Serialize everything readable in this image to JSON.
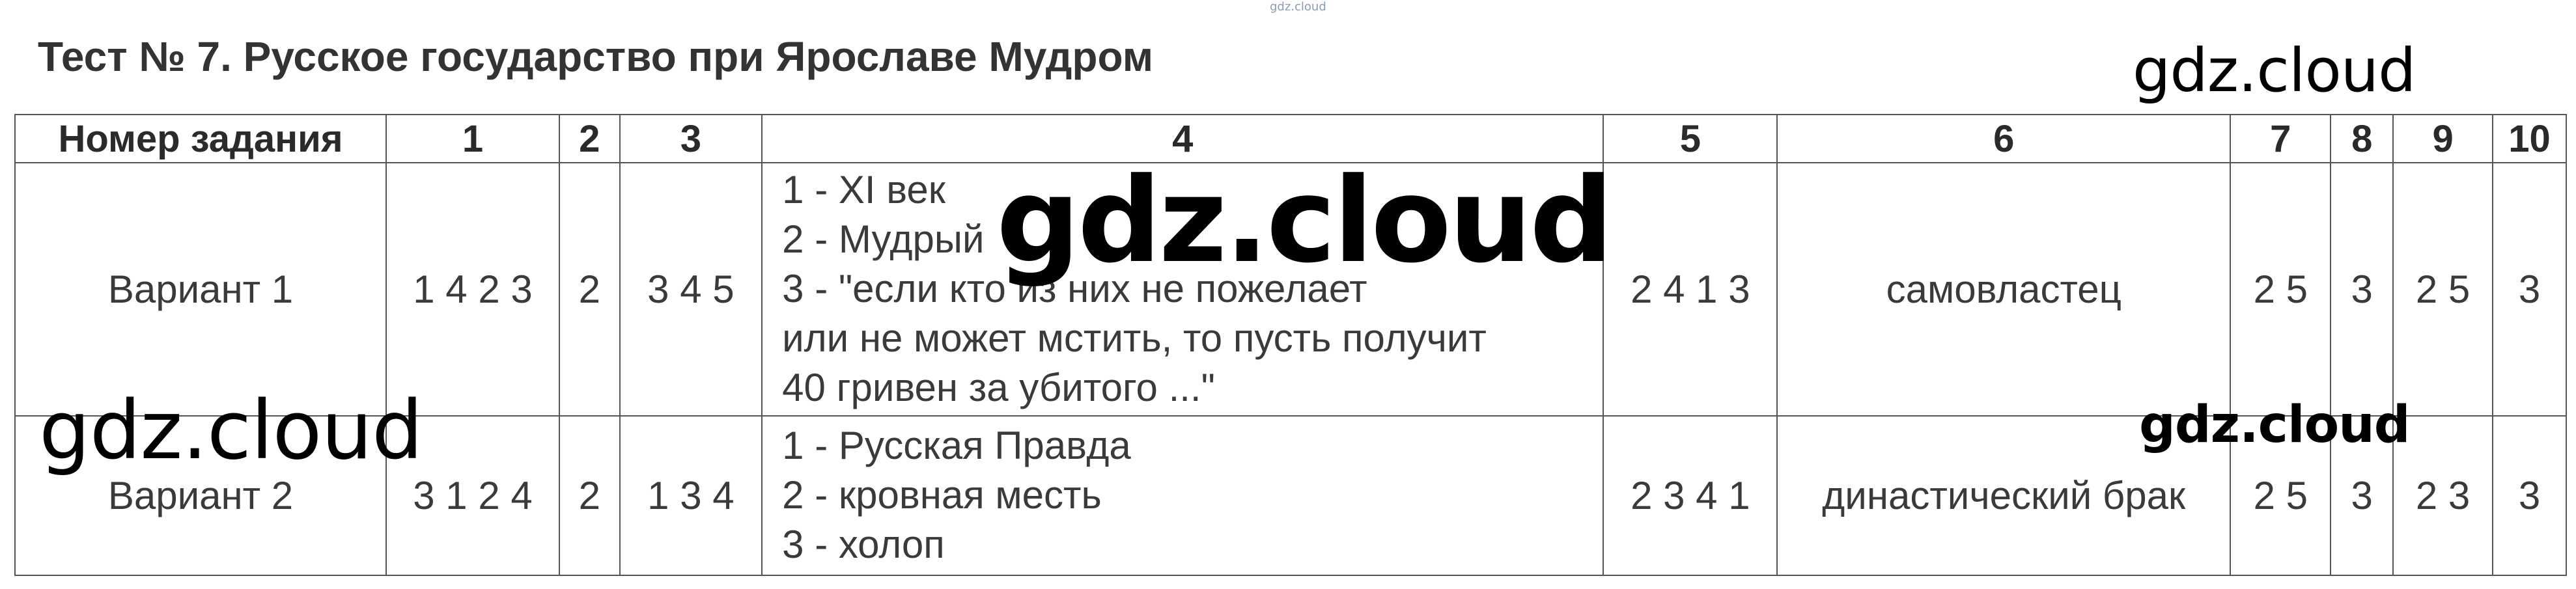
{
  "top_mark": "gdz.cloud",
  "title": "Тест № 7. Русское государство при Ярославе Мудром",
  "table": {
    "headers": [
      "Номер задания",
      "1",
      "2",
      "3",
      "4",
      "5",
      "6",
      "7",
      "8",
      "9",
      "10"
    ],
    "rows": [
      {
        "variant": "Вариант 1",
        "c1": "1 4 2 3",
        "c2": "2",
        "c3": "3 4 5",
        "c4_lines": [
          "1 - XI век",
          "2 - Мудрый",
          "3 - \"если кто из них не пожелает",
          "или не может мстить, то пусть получит",
          "40 гривен за убитого ...\""
        ],
        "c5": "2 4 1 3",
        "c6": "самовластец",
        "c7": "2 5",
        "c8": "3",
        "c9": "2 5",
        "c10": "3"
      },
      {
        "variant": "Вариант 2",
        "c1": "3 1 2 4",
        "c2": "2",
        "c3": "1 3 4",
        "c4_lines": [
          "1 - Русская Правда",
          "2 - кровная месть",
          "3 - холоп"
        ],
        "c5": "2 3 4 1",
        "c6": "династический брак",
        "c7": "2 5",
        "c8": "3",
        "c9": "2 3",
        "c10": "3"
      }
    ]
  },
  "watermarks": {
    "top_right": "gdz.cloud",
    "center": "gdz.cloud",
    "left": "gdz.cloud",
    "right_small": "gdz.cloud"
  }
}
